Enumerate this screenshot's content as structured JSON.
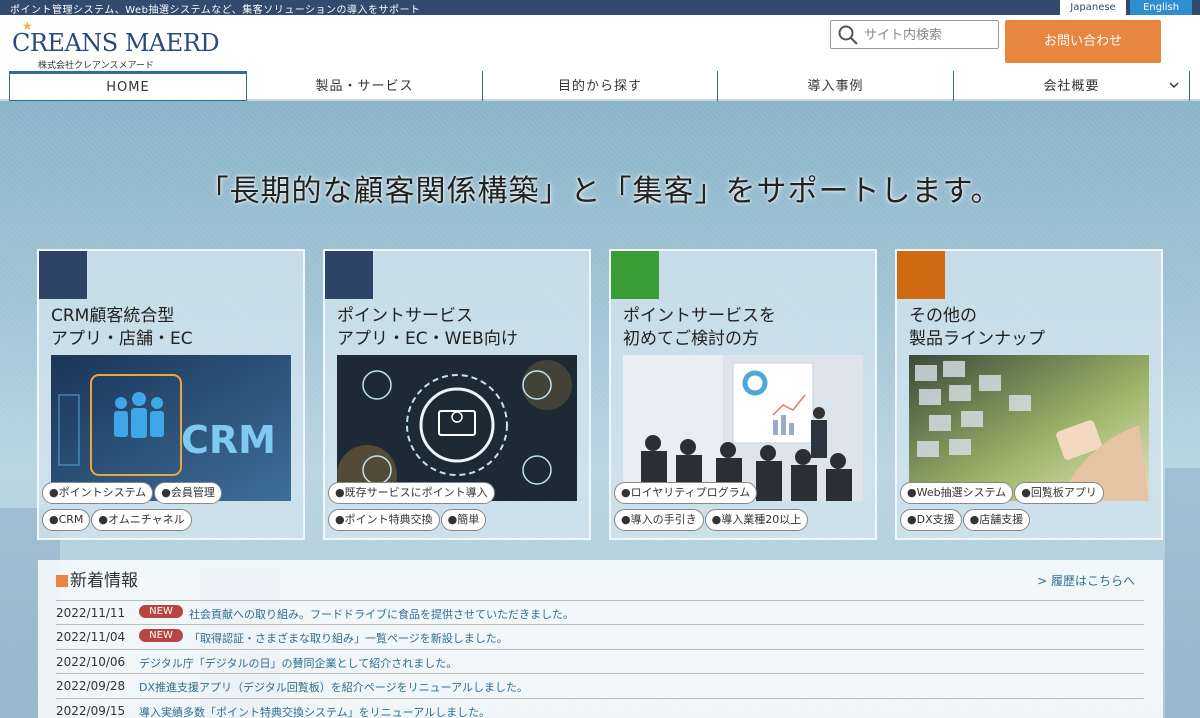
{
  "topbar": {
    "tagline": "ポイント管理システム、Web抽選システムなど、集客ソリューションの導入をサポート",
    "lang_jp": "Japanese",
    "lang_en": "English"
  },
  "header": {
    "logo_main": "CREANS MAERD",
    "logo_sub": "株式会社クレアンスメアード",
    "search_placeholder": "サイト内検索",
    "contact_label": "お問い合わせ"
  },
  "nav": {
    "items": [
      {
        "label": "HOME"
      },
      {
        "label": "製品・サービス"
      },
      {
        "label": "目的から探す"
      },
      {
        "label": "導入事例"
      },
      {
        "label": "会社概要"
      }
    ]
  },
  "hero": {
    "headline": "「長期的な顧客関係構築」と「集客」をサポートします。"
  },
  "cards": [
    {
      "title": "CRM顧客統合型\nアプリ・店舗・EC",
      "accent": "#2e4466",
      "image_text": "CRM",
      "tags": [
        "●ポイントシステム",
        "●会員管理",
        "●CRM",
        "●オムニチャネル"
      ]
    },
    {
      "title": "ポイントサービス\nアプリ・EC・WEB向け",
      "accent": "#2e4466",
      "tags": [
        "●既存サービスにポイント導入",
        "●ポイント特典交換",
        "●簡単"
      ]
    },
    {
      "title": "ポイントサービスを\n初めてご検討の方",
      "accent": "#3a9e36",
      "tags": [
        "●ロイヤリティプログラム",
        "●導入の手引き",
        "●導入業種20以上"
      ]
    },
    {
      "title": "その他の\n製品ラインナップ",
      "accent": "#cf6a12",
      "tags": [
        "●Web抽選システム",
        "●回覧板アプリ",
        "●DX支援",
        "●店舗支援"
      ]
    }
  ],
  "news": {
    "title": "新着情報",
    "more": "> 履歴はこちらへ",
    "items": [
      {
        "date": "2022/11/11",
        "badge": "NEW",
        "text": "社会貢献への取り組み。フードドライブに食品を提供させていただきました。"
      },
      {
        "date": "2022/11/04",
        "badge": "NEW",
        "text": "「取得認証・さまざまな取り組み」一覧ページを新設しました。"
      },
      {
        "date": "2022/10/06",
        "badge": "",
        "text": "デジタル庁「デジタルの日」の賛同企業として紹介されました。"
      },
      {
        "date": "2022/09/28",
        "badge": "",
        "text": "DX推進支援アプリ（デジタル回覧板）を紹介ページをリニューアルしました。"
      },
      {
        "date": "2022/09/15",
        "badge": "",
        "text": "導入実績多数「ポイント特典交換システム」をリニューアルしました。"
      }
    ]
  }
}
